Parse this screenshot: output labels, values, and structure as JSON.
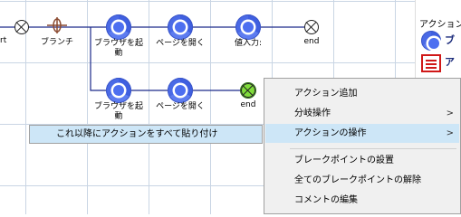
{
  "flow": {
    "row1": [
      {
        "type": "end-partial",
        "label": "rt"
      },
      {
        "type": "branch",
        "label": "ブランチ"
      },
      {
        "type": "browser",
        "label": "ブラウザを起\n動"
      },
      {
        "type": "browser",
        "label": "ページを開く"
      },
      {
        "type": "browser",
        "label": "値入力:"
      },
      {
        "type": "end",
        "label": "end"
      }
    ],
    "row2": [
      {
        "type": "browser",
        "label": "ブラウザを起\n動"
      },
      {
        "type": "browser",
        "label": "ページを開く"
      },
      {
        "type": "end",
        "label": "end",
        "selected": true
      }
    ]
  },
  "context_menu": {
    "items": [
      {
        "label": "アクション追加",
        "has_submenu": false
      },
      {
        "label": "分岐操作",
        "has_submenu": true
      },
      {
        "label": "アクションの操作",
        "has_submenu": true,
        "highlighted": true
      },
      {
        "label": "ブレークポイントの設置",
        "has_submenu": false
      },
      {
        "label": "全てのブレークポイントの解除",
        "has_submenu": false
      },
      {
        "label": "コメントの編集",
        "has_submenu": false
      }
    ],
    "arrow": ">"
  },
  "submenu": {
    "items": [
      {
        "label": "これ以降にアクションをすべて貼り付け",
        "highlighted": true
      }
    ]
  },
  "side_panel": {
    "heading": "アクション",
    "items": [
      {
        "icon": "browser-icon",
        "label": "ブ"
      },
      {
        "icon": "document-icon",
        "label": "ア"
      },
      {
        "icon": "folder-icon",
        "label": ""
      }
    ]
  },
  "colors": {
    "highlight": "#cde6f7",
    "menu_bg": "#f0f0f0",
    "grid": "#c9d5e4",
    "wire": "#1c2a8a",
    "browser_icon": "#4a6ae6",
    "end_selected": "#7fdc3a"
  }
}
